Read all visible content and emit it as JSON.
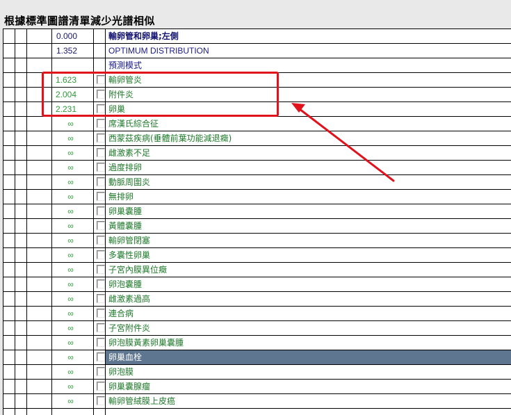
{
  "page_title": "根據標準圖譜清單減少光譜相似",
  "rows": [
    {
      "score": "0.000",
      "label": "輸卵管和卵巢;左側",
      "kind": "header",
      "score_style": "top",
      "checkbox": false
    },
    {
      "score": "1.352",
      "label": "OPTIMUM DISTRIBUTION",
      "kind": "optimum",
      "score_style": "top",
      "checkbox": false
    },
    {
      "score": "",
      "label": "預測模式",
      "kind": "mode",
      "score_style": "top",
      "checkbox": false
    },
    {
      "score": "1.623",
      "label": "輸卵管炎",
      "kind": "dx",
      "score_style": "green",
      "checkbox": true
    },
    {
      "score": "2.004",
      "label": "附件炎",
      "kind": "dx",
      "score_style": "green",
      "checkbox": true
    },
    {
      "score": "2.231",
      "label": "卵巢",
      "kind": "dx",
      "score_style": "green",
      "checkbox": true
    },
    {
      "score": "∞",
      "label": "席漢氏綜合征",
      "kind": "dx",
      "score_style": "inf",
      "checkbox": true
    },
    {
      "score": "∞",
      "label": "西蒙茲疾病(垂體前葉功能減退癥)",
      "kind": "dx",
      "score_style": "inf",
      "checkbox": true
    },
    {
      "score": "∞",
      "label": "雌激素不足",
      "kind": "dx",
      "score_style": "inf",
      "checkbox": true
    },
    {
      "score": "∞",
      "label": "過度排卵",
      "kind": "dx",
      "score_style": "inf",
      "checkbox": true
    },
    {
      "score": "∞",
      "label": "動脈周圍炎",
      "kind": "dx",
      "score_style": "inf",
      "checkbox": true
    },
    {
      "score": "∞",
      "label": "無排卵",
      "kind": "dx",
      "score_style": "inf",
      "checkbox": true
    },
    {
      "score": "∞",
      "label": "卵巢囊腫",
      "kind": "dx",
      "score_style": "inf",
      "checkbox": true
    },
    {
      "score": "∞",
      "label": "黃體囊腫",
      "kind": "dx",
      "score_style": "inf",
      "checkbox": true
    },
    {
      "score": "∞",
      "label": "輸卵管閉塞",
      "kind": "dx",
      "score_style": "inf",
      "checkbox": true
    },
    {
      "score": "∞",
      "label": "多囊性卵巢",
      "kind": "dx",
      "score_style": "inf",
      "checkbox": true
    },
    {
      "score": "∞",
      "label": "子宮內膜異位癥",
      "kind": "dx",
      "score_style": "inf",
      "checkbox": true
    },
    {
      "score": "∞",
      "label": "卵泡囊腫",
      "kind": "dx",
      "score_style": "inf",
      "checkbox": true
    },
    {
      "score": "∞",
      "label": "雌激素過高",
      "kind": "dx",
      "score_style": "inf",
      "checkbox": true
    },
    {
      "score": "∞",
      "label": "連合病",
      "kind": "dx",
      "score_style": "inf",
      "checkbox": true
    },
    {
      "score": "∞",
      "label": "子宮附件炎",
      "kind": "dx",
      "score_style": "inf",
      "checkbox": true
    },
    {
      "score": "∞",
      "label": "卵泡膜黃素卵巢囊腫",
      "kind": "dx",
      "score_style": "inf",
      "checkbox": true
    },
    {
      "score": "∞",
      "label": "卵巢血栓",
      "kind": "dx",
      "score_style": "inf",
      "checkbox": true,
      "selected": true
    },
    {
      "score": "∞",
      "label": "卵泡膜",
      "kind": "dx",
      "score_style": "inf",
      "checkbox": true
    },
    {
      "score": "∞",
      "label": "卵巢囊腺瘤",
      "kind": "dx",
      "score_style": "inf",
      "checkbox": true
    },
    {
      "score": "∞",
      "label": "輸卵管絨膜上皮癌",
      "kind": "dx",
      "score_style": "inf",
      "checkbox": true
    },
    {
      "score": "",
      "label": "",
      "kind": "dx",
      "score_style": "inf",
      "checkbox": false
    }
  ],
  "colors": {
    "annotation": "#e0121c",
    "selection": "#5f7690",
    "score_green": "#2e9a3a",
    "label_green": "#1f7a2a"
  },
  "icons": {
    "annotation_arrow": "red-arrow-icon",
    "annotation_box": "red-highlight-box"
  }
}
